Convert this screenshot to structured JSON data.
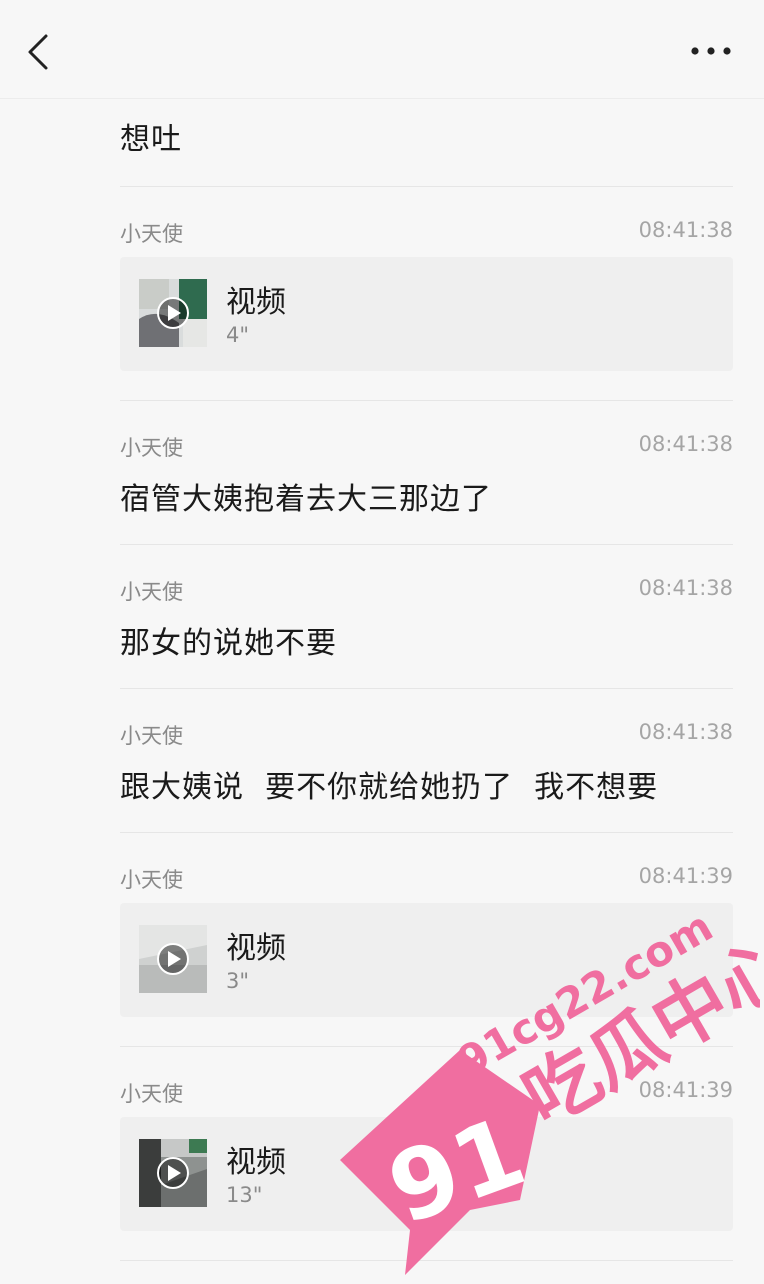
{
  "header": {
    "back_icon": "chevron-left-icon",
    "more_icon": "more-horizontal-icon"
  },
  "messages": [
    {
      "type": "text",
      "sender": "",
      "time": "",
      "text": "想吐"
    },
    {
      "type": "video",
      "sender": "小天使",
      "time": "08:41:38",
      "label": "视频",
      "duration": "4\""
    },
    {
      "type": "text",
      "sender": "小天使",
      "time": "08:41:38",
      "text": "宿管大姨抱着去大三那边了"
    },
    {
      "type": "text",
      "sender": "小天使",
      "time": "08:41:38",
      "text": "那女的说她不要"
    },
    {
      "type": "text",
      "sender": "小天使",
      "time": "08:41:38",
      "text": "跟大姨说  要不你就给她扔了  我不想要"
    },
    {
      "type": "video",
      "sender": "小天使",
      "time": "08:41:39",
      "label": "视频",
      "duration": "3\""
    },
    {
      "type": "video",
      "sender": "小天使",
      "time": "08:41:39",
      "label": "视频",
      "duration": "13\""
    }
  ],
  "watermark": {
    "domain": "91cg22.com",
    "badge": "91",
    "title": "吃瓜中心",
    "color": "#f06ea0"
  }
}
